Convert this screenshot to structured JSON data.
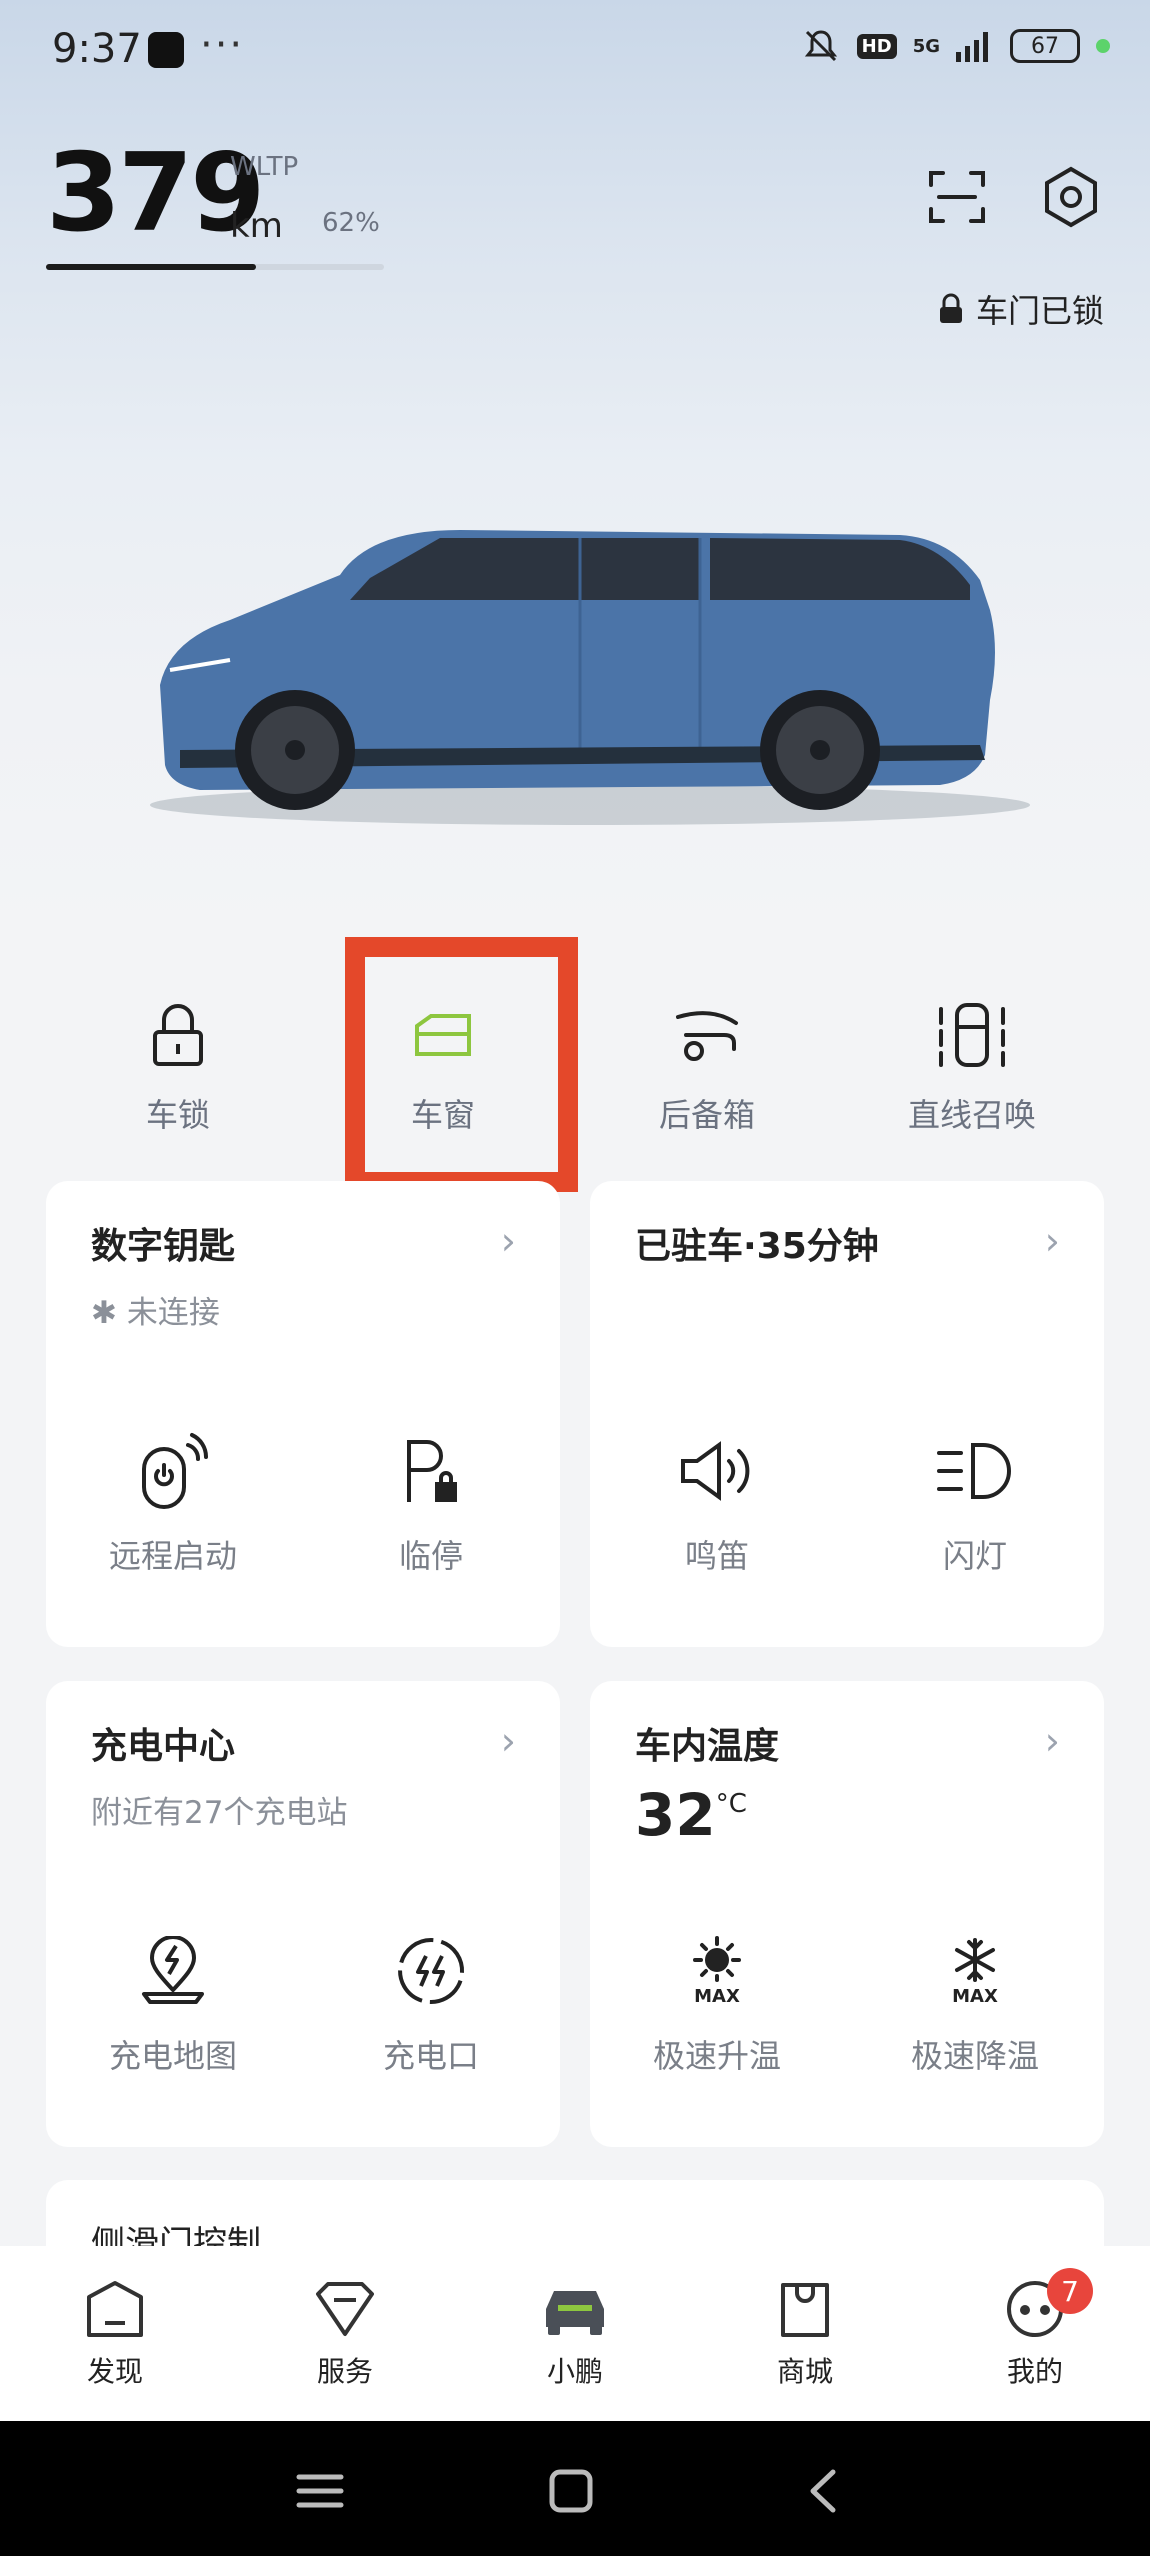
{
  "status_bar": {
    "time": "9:37",
    "dots": "···",
    "signal": "5G",
    "hd": "HD",
    "battery": "67"
  },
  "range": {
    "value": "379",
    "standard": "WLTP",
    "unit": "km",
    "percent": "62%",
    "fill_fraction": 0.62
  },
  "door_status": "车门已锁",
  "quick_actions": [
    {
      "label": "车锁",
      "icon": "lock-icon"
    },
    {
      "label": "车窗",
      "icon": "window-icon"
    },
    {
      "label": "后备箱",
      "icon": "trunk-icon"
    },
    {
      "label": "直线召唤",
      "icon": "summon-icon"
    }
  ],
  "cards": {
    "digital_key": {
      "title": "数字钥匙",
      "status": "未连接",
      "actions": [
        {
          "label": "远程启动"
        },
        {
          "label": "临停"
        }
      ]
    },
    "parked": {
      "title": "已驻车·35分钟",
      "actions": [
        {
          "label": "鸣笛"
        },
        {
          "label": "闪灯"
        }
      ]
    },
    "charging": {
      "title": "充电中心",
      "subtitle": "附近有27个充电站",
      "actions": [
        {
          "label": "充电地图"
        },
        {
          "label": "充电口"
        }
      ]
    },
    "cabin_temp": {
      "title": "车内温度",
      "value": "32",
      "unit": "°C",
      "actions": [
        {
          "label": "极速升温",
          "icon_text": "MAX"
        },
        {
          "label": "极速降温",
          "icon_text": "MAX"
        }
      ]
    },
    "side_door": {
      "title": "侧滑门控制"
    }
  },
  "tab_bar": {
    "tabs": [
      {
        "label": "发现"
      },
      {
        "label": "服务"
      },
      {
        "label": "小鹏"
      },
      {
        "label": "商城"
      },
      {
        "label": "我的",
        "badge": "7"
      }
    ]
  },
  "colors": {
    "accent_green": "#8dc63f",
    "highlight_red": "#e4482a",
    "car_blue": "#4b74a8"
  }
}
